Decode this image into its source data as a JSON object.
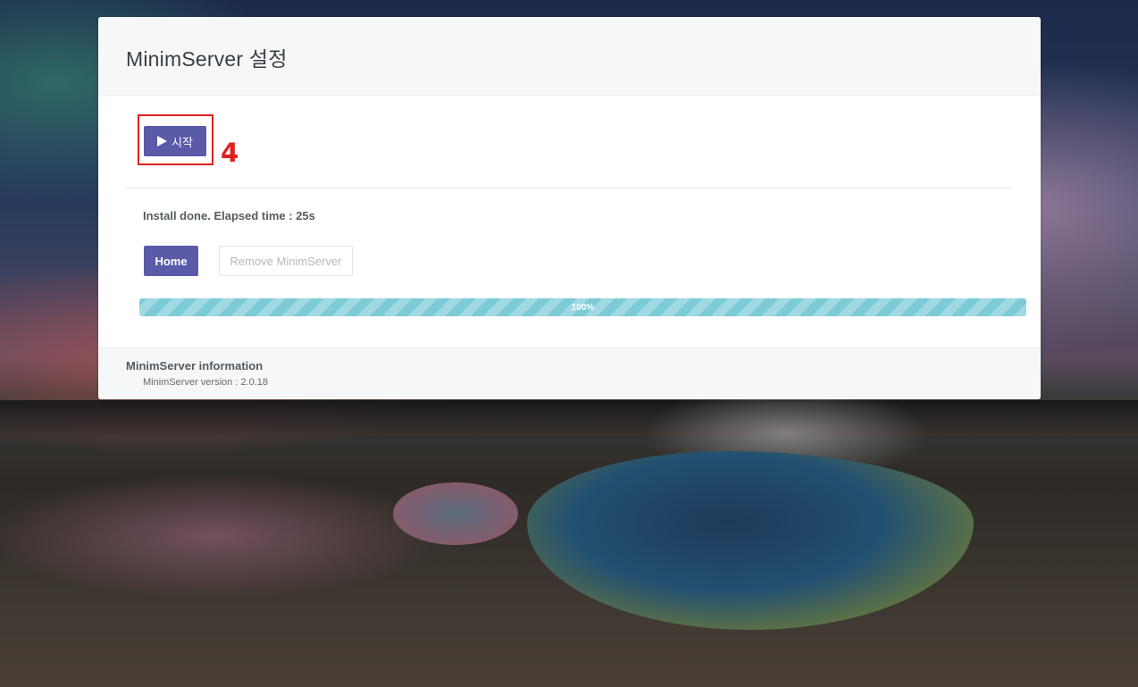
{
  "panel": {
    "title": "MinimServer 설정"
  },
  "actions": {
    "start_label": "시작",
    "step_number": "4"
  },
  "status": {
    "message": "Install done. Elapsed time : 25s"
  },
  "buttons": {
    "home_label": "Home",
    "remove_label": "Remove MinimServer"
  },
  "progress": {
    "value": 100,
    "label": "100%"
  },
  "info": {
    "title": "MinimServer information",
    "version_line": "MinimServer version : 2.0.18"
  },
  "icons": {
    "start": "play-icon"
  },
  "colors": {
    "primary_button": "#5a5aa8",
    "progress_fill": "#7ccbd6",
    "highlight": "#e02020"
  }
}
